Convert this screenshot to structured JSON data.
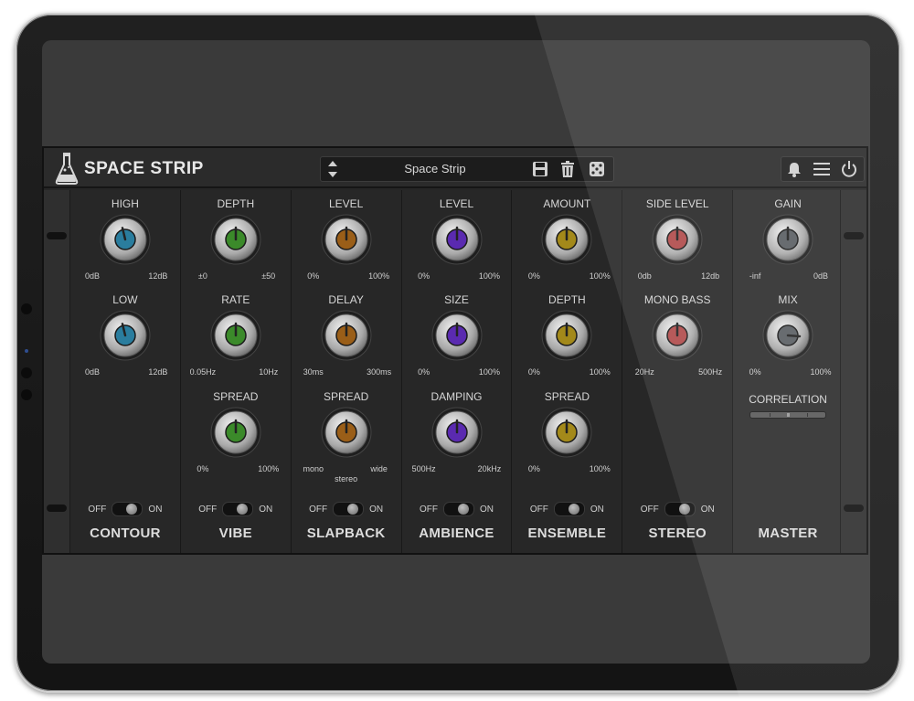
{
  "app": {
    "title": "SPACE STRIP"
  },
  "preset": {
    "name": "Space Strip"
  },
  "toolbar": {
    "icons": [
      "up-down-arrows-icon",
      "save-icon",
      "trash-icon",
      "dice-icon",
      "bell-icon",
      "menu-icon",
      "power-icon"
    ]
  },
  "colors": {
    "blue": "#2a7d9e",
    "green": "#3b8a2a",
    "orange": "#9a5e18",
    "purple": "#5a2ab0",
    "gold": "#a3891a",
    "red": "#b04a4a",
    "gray": "#5a5e62"
  },
  "modules": [
    {
      "name": "CONTOUR",
      "toggle": {
        "off": "OFF",
        "on": "ON"
      },
      "params": [
        {
          "label": "HIGH",
          "min": "0dB",
          "max": "12dB",
          "color": "blue",
          "value": 0.45
        },
        {
          "label": "LOW",
          "min": "0dB",
          "max": "12dB",
          "color": "blue",
          "value": 0.45
        }
      ]
    },
    {
      "name": "VIBE",
      "toggle": {
        "off": "OFF",
        "on": "ON"
      },
      "params": [
        {
          "label": "DEPTH",
          "min": "±0",
          "max": "±50",
          "color": "green",
          "value": 0.5
        },
        {
          "label": "RATE",
          "min": "0.05Hz",
          "max": "10Hz",
          "color": "green",
          "value": 0.5
        },
        {
          "label": "SPREAD",
          "min": "0%",
          "max": "100%",
          "color": "green",
          "value": 0.5
        }
      ]
    },
    {
      "name": "SLAPBACK",
      "toggle": {
        "off": "OFF",
        "on": "ON"
      },
      "params": [
        {
          "label": "LEVEL",
          "min": "0%",
          "max": "100%",
          "color": "orange",
          "value": 0.5
        },
        {
          "label": "DELAY",
          "min": "30ms",
          "max": "300ms",
          "color": "orange",
          "value": 0.5
        },
        {
          "label": "SPREAD",
          "min": "mono",
          "max": "wide",
          "mid": "stereo",
          "color": "orange",
          "value": 0.5
        }
      ]
    },
    {
      "name": "AMBIENCE",
      "toggle": {
        "off": "OFF",
        "on": "ON"
      },
      "params": [
        {
          "label": "LEVEL",
          "min": "0%",
          "max": "100%",
          "color": "purple",
          "value": 0.5
        },
        {
          "label": "SIZE",
          "min": "0%",
          "max": "100%",
          "color": "purple",
          "value": 0.5
        },
        {
          "label": "DAMPING",
          "min": "500Hz",
          "max": "20kHz",
          "color": "purple",
          "value": 0.5
        }
      ]
    },
    {
      "name": "ENSEMBLE",
      "toggle": {
        "off": "OFF",
        "on": "ON"
      },
      "params": [
        {
          "label": "AMOUNT",
          "min": "0%",
          "max": "100%",
          "color": "gold",
          "value": 0.5
        },
        {
          "label": "DEPTH",
          "min": "0%",
          "max": "100%",
          "color": "gold",
          "value": 0.5
        },
        {
          "label": "SPREAD",
          "min": "0%",
          "max": "100%",
          "color": "gold",
          "value": 0.5
        }
      ]
    },
    {
      "name": "STEREO",
      "toggle": {
        "off": "OFF",
        "on": "ON"
      },
      "params": [
        {
          "label": "SIDE LEVEL",
          "min": "0db",
          "max": "12db",
          "color": "red",
          "value": 0.5
        },
        {
          "label": "MONO BASS",
          "min": "20Hz",
          "max": "500Hz",
          "color": "red",
          "value": 0.5
        }
      ]
    },
    {
      "name": "MASTER",
      "params": [
        {
          "label": "GAIN",
          "min": "-inf",
          "max": "0dB",
          "color": "gray",
          "value": 0.5
        },
        {
          "label": "MIX",
          "min": "0%",
          "max": "100%",
          "color": "gray",
          "value": 0.85
        }
      ],
      "correlation": {
        "label": "CORRELATION",
        "value": 0.5
      }
    }
  ]
}
